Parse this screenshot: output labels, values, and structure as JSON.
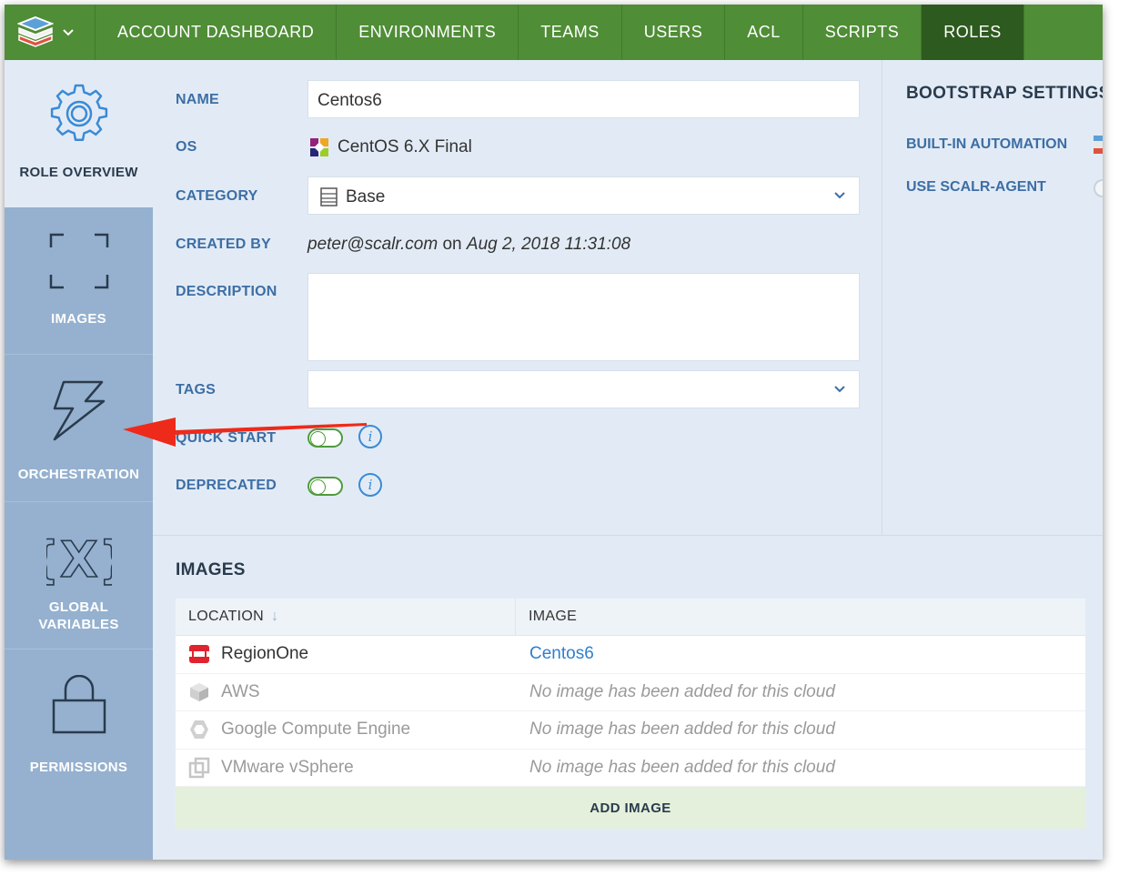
{
  "nav": {
    "items": [
      {
        "label": "ACCOUNT DASHBOARD",
        "active": false
      },
      {
        "label": "ENVIRONMENTS",
        "active": false
      },
      {
        "label": "TEAMS",
        "active": false
      },
      {
        "label": "USERS",
        "active": false
      },
      {
        "label": "ACL",
        "active": false
      },
      {
        "label": "SCRIPTS",
        "active": false
      },
      {
        "label": "ROLES",
        "active": true
      }
    ]
  },
  "sidebar": {
    "items": [
      {
        "label": "ROLE OVERVIEW",
        "icon": "gear-icon",
        "active": true
      },
      {
        "label": "IMAGES",
        "icon": "frame-icon",
        "active": false
      },
      {
        "label": "ORCHESTRATION",
        "icon": "lightning-icon",
        "active": false
      },
      {
        "label_line1": "GLOBAL",
        "label_line2": "VARIABLES",
        "icon": "variable-icon",
        "active": false
      },
      {
        "label": "PERMISSIONS",
        "icon": "lock-icon",
        "active": false
      }
    ]
  },
  "form": {
    "name_label": "NAME",
    "name_value": "Centos6",
    "os_label": "OS",
    "os_value": "CentOS 6.X Final",
    "category_label": "CATEGORY",
    "category_value": "Base",
    "created_by_label": "CREATED BY",
    "created_by_user": "peter@scalr.com",
    "created_by_on": "on",
    "created_by_date": "Aug 2, 2018 11:31:08",
    "description_label": "DESCRIPTION",
    "description_value": "",
    "tags_label": "TAGS",
    "tags_value": "",
    "quick_start_label": "QUICK START",
    "quick_start_on": false,
    "deprecated_label": "DEPRECATED",
    "deprecated_on": false,
    "info_glyph": "i"
  },
  "bootstrap": {
    "title": "BOOTSTRAP SETTINGS",
    "builtin_label": "BUILT-IN AUTOMATION",
    "agent_label": "USE SCALR-AGENT"
  },
  "images": {
    "title": "IMAGES",
    "col_location": "LOCATION",
    "col_image": "IMAGE",
    "sort_indicator": "↓",
    "rows": [
      {
        "location": "RegionOne",
        "image": "Centos6",
        "icon": "openstack-icon",
        "has_image": true
      },
      {
        "location": "AWS",
        "image": "No image has been added for this cloud",
        "icon": "aws-icon",
        "has_image": false
      },
      {
        "location": "Google Compute Engine",
        "image": "No image has been added for this cloud",
        "icon": "gce-icon",
        "has_image": false
      },
      {
        "location": "VMware vSphere",
        "image": "No image has been added for this cloud",
        "icon": "vmware-icon",
        "has_image": false
      }
    ],
    "add_label": "ADD IMAGE"
  },
  "colors": {
    "nav_green": "#4f8d36",
    "nav_active": "#2d5a1e",
    "label_blue": "#3d6ea5",
    "sidebar": "#95b1cf",
    "link_blue": "#2f7fcf",
    "annotation_red": "#ee2a1b"
  }
}
